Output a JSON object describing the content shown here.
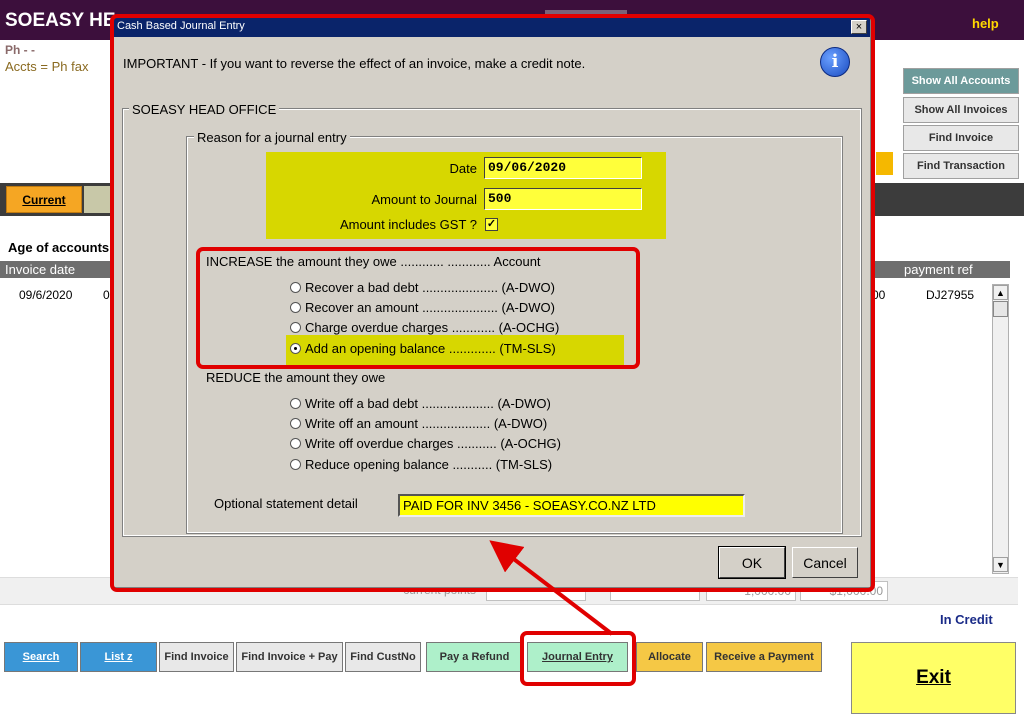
{
  "app": {
    "title": "SOEASY HE",
    "help": "help",
    "ph_line": "Ph  -  -",
    "accts_line": "Accts =  Ph  fax"
  },
  "side_buttons": [
    "Show All Accounts",
    "Show All Invoices",
    "Find Invoice",
    "Find Transaction"
  ],
  "tabs": {
    "current": "Current"
  },
  "age_label": "Age of accounts",
  "grid": {
    "headers": {
      "invoice_date": "Invoice date",
      "payment_ref": "payment ref"
    },
    "row": {
      "invoice_date": "09/6/2020",
      "col2": "0",
      "amount": "00",
      "payment_ref": "DJ27955"
    }
  },
  "totals": {
    "label": "current  points",
    "total1": "1,000.00",
    "total2": "$1,000.00"
  },
  "in_credit": "In Credit",
  "bottom_buttons": [
    "Search",
    "List z",
    "Find Invoice",
    "Find Invoice + Pay",
    "Find CustNo",
    "Pay a Refund",
    "Journal Entry",
    "Allocate",
    "Receive a Payment"
  ],
  "exit_label": "Exit",
  "dialog": {
    "title": "Cash Based Journal Entry",
    "close": "×",
    "important": "IMPORTANT - If you want to reverse the effect of an invoice, make a credit note.",
    "info_icon": "i",
    "office": "SOEASY HEAD OFFICE",
    "reason_label": "Reason for a journal entry",
    "date_label": "Date",
    "date_value": "09/06/2020",
    "amount_label": "Amount to Journal",
    "amount_value": "500",
    "gst_label": "Amount includes GST ?",
    "gst_checked": "✓",
    "increase_header": "INCREASE the amount they owe ............ ............ Account",
    "increase_options": [
      "Recover a bad debt ..................... (A-DWO)",
      "Recover an amount ..................... (A-DWO)",
      "Charge overdue charges ............ (A-OCHG)",
      "Add an opening balance ............. (TM-SLS)"
    ],
    "reduce_header": "REDUCE the amount they owe",
    "reduce_options": [
      "Write off a bad debt .................... (A-DWO)",
      "Write off an amount ................... (A-DWO)",
      "Write off overdue charges ........... (A-OCHG)",
      "Reduce opening balance ........... (TM-SLS)"
    ],
    "statement_label": "Optional statement detail",
    "statement_value": "PAID FOR INV 3456 - SOEASY.CO.NZ LTD",
    "ok": "OK",
    "cancel": "Cancel"
  },
  "colors": {
    "annotation_red": "#e00000",
    "highlight_yellow": "#d7d700",
    "titlebar": "#0a246a"
  }
}
